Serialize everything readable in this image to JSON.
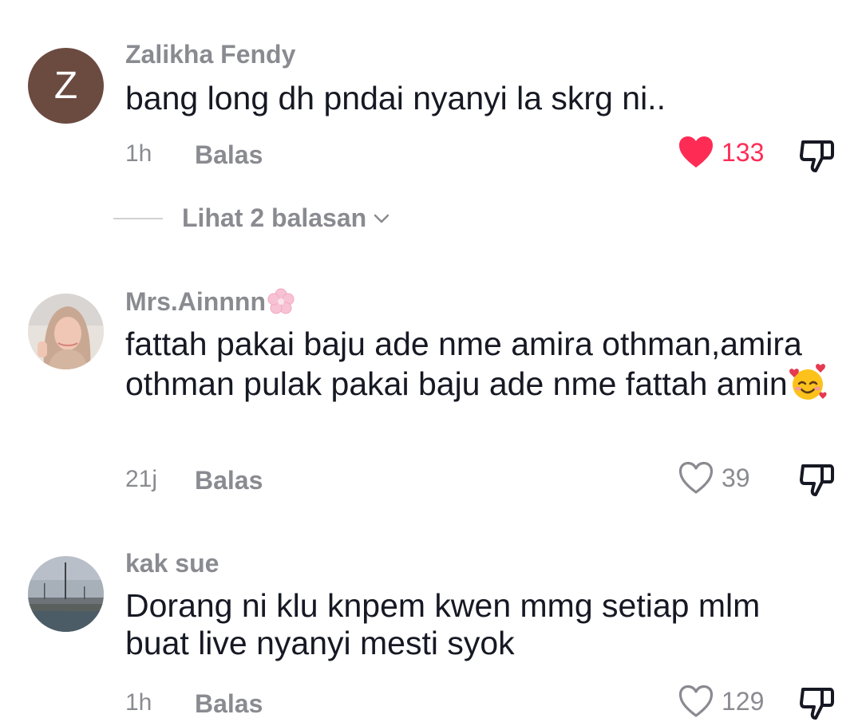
{
  "comments": [
    {
      "avatar_letter": "Z",
      "username": "Zalikha Fendy",
      "text": "bang long dh pndai nyanyi la skrg ni..",
      "time": "1h",
      "reply_label": "Balas",
      "like_count": "133",
      "liked": true,
      "view_replies_label": "Lihat 2 balasan"
    },
    {
      "username": "Mrs.Ainnnn",
      "username_icon": "cherry-blossom-icon",
      "text": "fattah pakai baju ade nme amira othman,amira othman pulak pakai baju ade nme fattah amin",
      "text_emoji": "smiling-face-with-hearts-icon",
      "time": "21j",
      "reply_label": "Balas",
      "like_count": "39",
      "liked": false
    },
    {
      "username": "kak sue",
      "text": "Dorang ni klu knpem kwen mmg setiap mlm buat live nyanyi mesti syok",
      "time": "1h",
      "reply_label": "Balas",
      "like_count": "129",
      "liked": false
    }
  ],
  "colors": {
    "liked_heart": "#fe2c55",
    "secondary_text": "#8a8b91",
    "primary_text": "#161823"
  }
}
